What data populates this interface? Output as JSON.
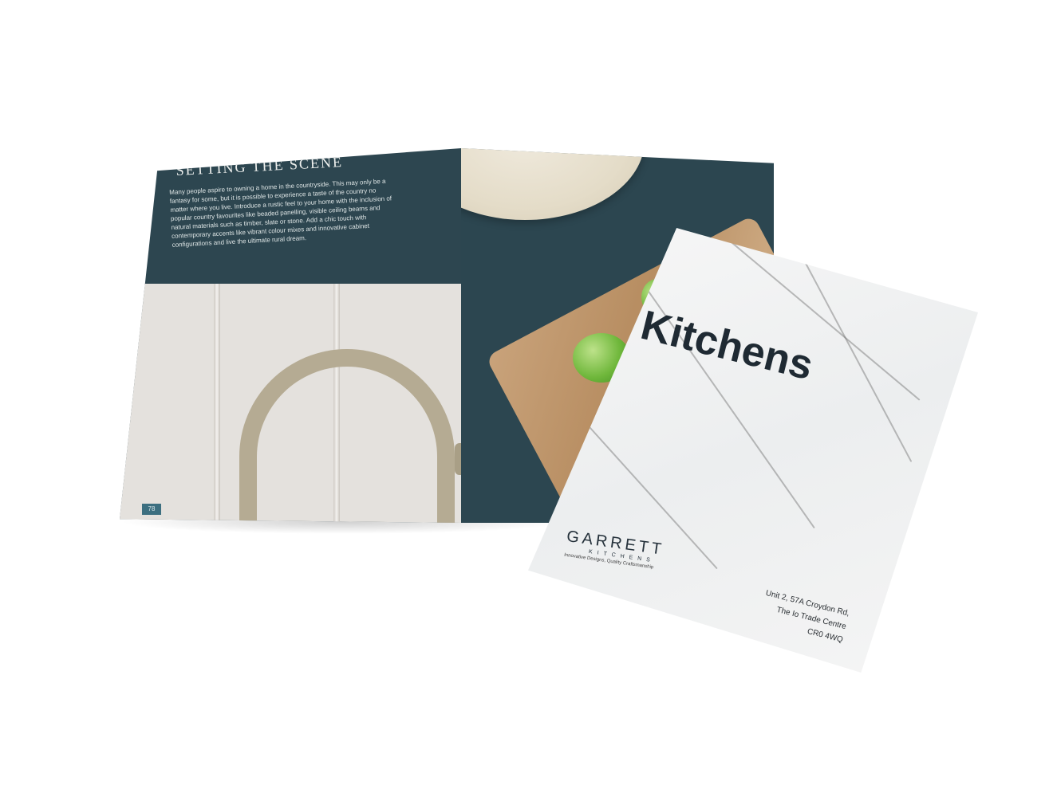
{
  "brochure": {
    "heading": "SETTING THE SCENE",
    "body": "Many people aspire to owning a home in the countryside. This may only be a fantasy for some, but it is possible to experience a taste of the country no matter where you live. Introduce a rustic feel to your home with the inclusion of popular country favourites like beaded panelling, visible ceiling beams and natural materials such as timber, slate or stone. Add a chic touch with contemporary accents like vibrant colour mixes and innovative cabinet configurations and live the ultimate rural dream.",
    "page_number": "78"
  },
  "cover": {
    "title": "Kitchens",
    "logo": {
      "brand": "GARRETT",
      "sub": "KITCHENS",
      "tagline": "Innovative Designs, Quality Craftsmanship"
    },
    "address": {
      "line1": "Unit 2, 57A Croydon Rd,",
      "line2": "The Io Trade Centre",
      "line3": "CR0 4WQ"
    }
  },
  "colors": {
    "page_teal": "#2d4650",
    "panel": "#e4e1dd",
    "marble": "#eceeef",
    "text_dark": "#1f2a33"
  }
}
